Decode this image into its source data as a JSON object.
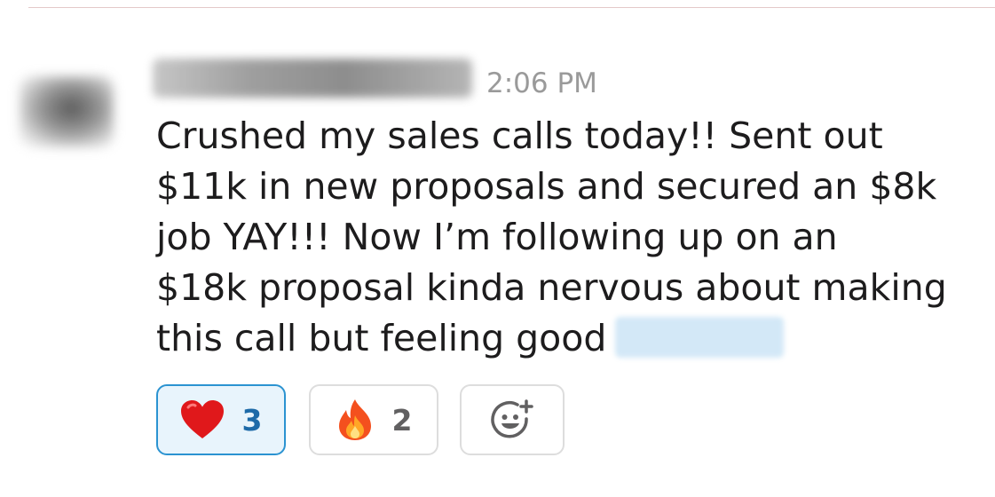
{
  "message": {
    "timestamp": "2:06 PM",
    "body_lines": [
      "Crushed my sales calls today!! Sent out",
      "$11k in new proposals and secured an $8k",
      "job YAY!!! Now I’m following up on an",
      "$18k proposal kinda nervous about making",
      "this call but feeling good"
    ]
  },
  "reactions": [
    {
      "emoji": "heart-emoji",
      "count": "3",
      "selected": true
    },
    {
      "emoji": "fire-emoji",
      "count": "2",
      "selected": false
    }
  ],
  "add_reaction": {
    "icon": "add-reaction-icon"
  },
  "colors": {
    "text": "#1d1c1d",
    "timestamp": "#9a9a9a",
    "reaction_selected_border": "#2b93d1",
    "reaction_selected_bg": "#e8f4fc",
    "reaction_selected_count": "#1d6aa8",
    "reaction_border": "#dddddd",
    "mention_bg": "#d3e8f7",
    "divider": "#e4c9c9"
  }
}
